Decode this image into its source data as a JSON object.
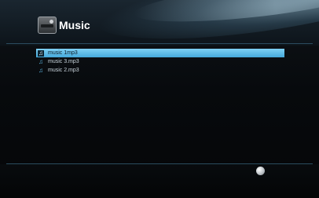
{
  "header": {
    "title": "Music",
    "icon": "music-folder-icon"
  },
  "list": {
    "items": [
      {
        "label": "music 1mp3",
        "icon": "music-note-icon",
        "selected": true
      },
      {
        "label": "music 3.mp3",
        "icon": "music-note-icon",
        "selected": false
      },
      {
        "label": "music 2.mp3",
        "icon": "music-note-icon",
        "selected": false
      }
    ]
  },
  "footer": {
    "icon": "disc-icon"
  },
  "colors": {
    "selection": "#5bb8e6",
    "accent_line": "#2a4c5e",
    "background": "#070a0d"
  }
}
